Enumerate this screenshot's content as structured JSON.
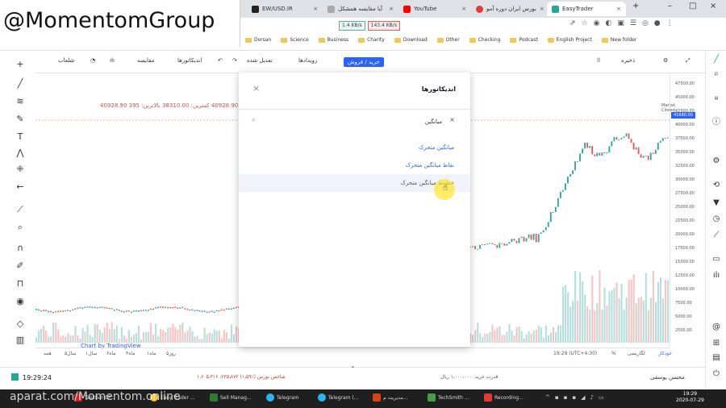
{
  "brand": {
    "text": "@MomentomGroup"
  },
  "browser": {
    "tabs": [
      {
        "label": "EW/USD.IR",
        "icon": "tradingview-icon",
        "color": "#222222"
      },
      {
        "label": "آیا مقایسه همشکل",
        "icon": "page-icon",
        "color": "#444444"
      },
      {
        "label": "YouTube",
        "icon": "youtube-icon",
        "color": "#ff0000"
      },
      {
        "label": "بورس ایران دوره آمو",
        "icon": "red-circle-icon",
        "color": "#e53935"
      },
      {
        "label": "EasyTrader",
        "icon": "easytrader-icon",
        "color": "#26a69a"
      }
    ],
    "net_up": "1.4 KB/s",
    "net_down": "143.4 KB/s",
    "bookmarks": [
      "Dorsan",
      "Science",
      "Business",
      "Charity",
      "Download",
      "Other",
      "Checking",
      "Podcast",
      "English Project",
      "New folder"
    ]
  },
  "toolbar": {
    "items": [
      "شلعاب",
      "مقایسه",
      "اندیکاتورها",
      "تعدیل شده",
      "رویدادها"
    ],
    "buy_sell": "خرید / فروش",
    "right_item": "ذخیره"
  },
  "chart": {
    "ohlc": "40928.90 بازگشت: 40928.90 کمترین: 38310.00 بالاترین: 395",
    "market_status": "Market Closed",
    "last_price": "41680.00",
    "price_ticks": [
      "47500.00",
      "45000.00",
      "42500.00",
      "40000.00",
      "37500.00",
      "35000.00",
      "32500.00",
      "30000.00",
      "27500.00",
      "25000.00",
      "22500.00",
      "20000.00",
      "17500.00",
      "15000.00",
      "12500.00",
      "10000.00",
      "7500.00",
      "5000.00",
      "2500.00"
    ],
    "tv_logo": "Chart by TradingView",
    "ranges": [
      "۵روز",
      "۱ماه",
      "۳ماه",
      "۶ماه",
      "۱سال",
      "۵سال",
      "همه"
    ],
    "time_display": "19:29 (UTC+4:30)",
    "right_labels": [
      "%",
      "لگاریتمی",
      "خودکار"
    ]
  },
  "dialog": {
    "title": "اندیکاتورها",
    "search_value": "میانگین",
    "results": [
      "میانگین متحرک",
      "نقاط میانگین متحرک",
      "خطوط میانگین متحرک"
    ]
  },
  "statusbar": {
    "clock": "19:29:24",
    "user": "محسن یوسفی",
    "stat_a": "۱،۶۰۵،۳۱۶ ،۲۲۵٫۸۷۲ (۱٫۵۹٪) شاخص بورس",
    "stat_b": "قدرت خرید: ۱،۰۰۰،۰۰۰ ریال"
  },
  "taskbar": {
    "watermark": "aparat.com/Momentom.online",
    "items": [
      "Taskbar CP...",
      "Easy Trader ...",
      "Sell Manag...",
      "Telegram",
      "Telegram (...",
      "مدیریت م...",
      "TechSmith ...",
      "Recording..."
    ],
    "time": "19:29",
    "date": "2020-07-29"
  }
}
